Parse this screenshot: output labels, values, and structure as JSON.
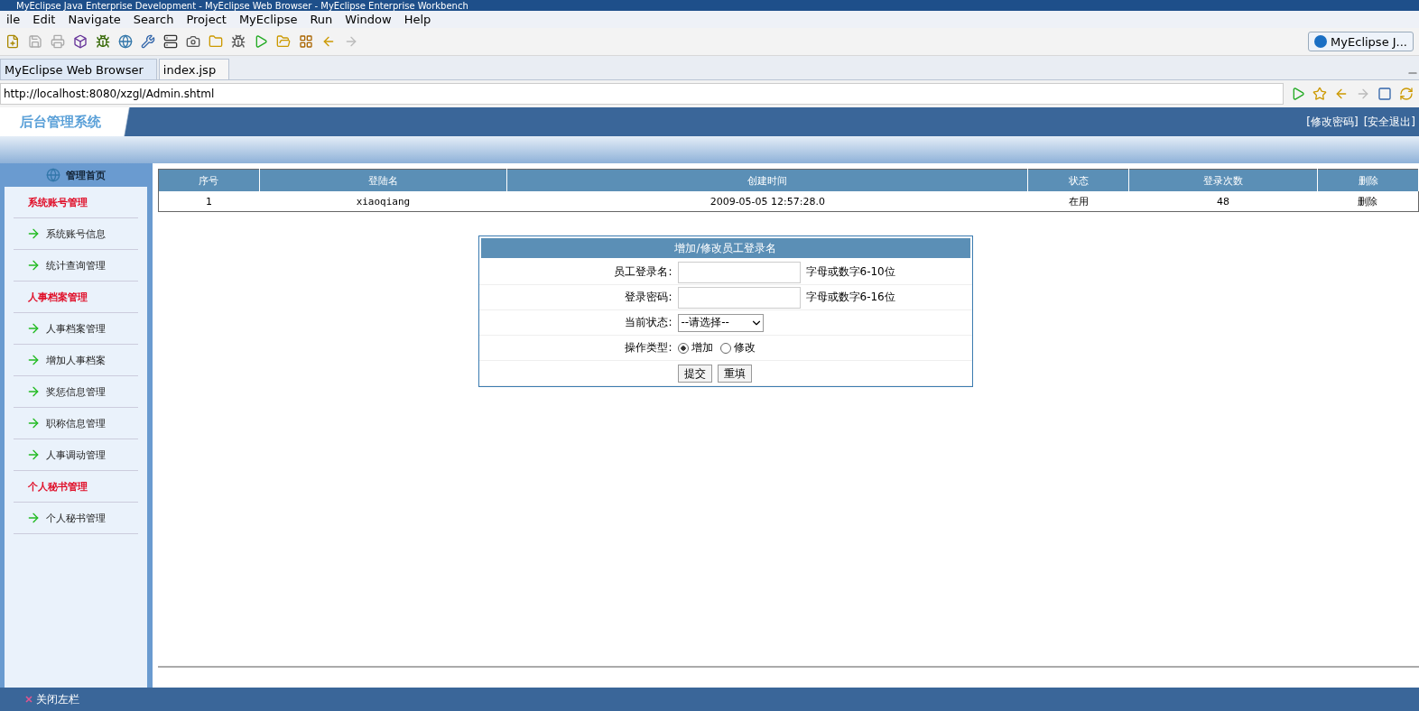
{
  "window": {
    "title": "MyEclipse Java Enterprise Development - MyEclipse Web Browser - MyEclipse Enterprise Workbench"
  },
  "menu": [
    "ile",
    "Edit",
    "Navigate",
    "Search",
    "Project",
    "MyEclipse",
    "Run",
    "Window",
    "Help"
  ],
  "perspective": {
    "label": "MyEclipse J..."
  },
  "tabs": [
    {
      "label": "MyEclipse Web Browser",
      "selected": true
    },
    {
      "label": "index.jsp",
      "selected": false
    }
  ],
  "address": {
    "value": "http://localhost:8080/xzgl/Admin.shtml"
  },
  "page": {
    "logo": "后台管理系统",
    "header_links": [
      "[修改密码]",
      "[安全退出]"
    ],
    "home": "管理首页",
    "sidebar": [
      {
        "kind": "section",
        "label": "系统账号管理"
      },
      {
        "kind": "link",
        "label": "系统账号信息"
      },
      {
        "kind": "link",
        "label": "统计查询管理"
      },
      {
        "kind": "section",
        "label": "人事档案管理"
      },
      {
        "kind": "link",
        "label": "人事档案管理"
      },
      {
        "kind": "link",
        "label": "增加人事档案"
      },
      {
        "kind": "link",
        "label": "奖惩信息管理"
      },
      {
        "kind": "link",
        "label": "职称信息管理"
      },
      {
        "kind": "link",
        "label": "人事调动管理"
      },
      {
        "kind": "section",
        "label": "个人秘书管理"
      },
      {
        "kind": "link",
        "label": "个人秘书管理"
      }
    ],
    "table": {
      "columns": [
        "序号",
        "登陆名",
        "创建时间",
        "状态",
        "登录次数",
        "删除"
      ],
      "rows": [
        [
          "1",
          "xiaoqiang",
          "2009-05-05 12:57:28.0",
          "在用",
          "48",
          "删除"
        ]
      ]
    },
    "form": {
      "title": "增加/修改员工登录名",
      "rows": [
        {
          "kind": "text",
          "label": "员工登录名:",
          "hint": "字母或数字6-10位"
        },
        {
          "kind": "text",
          "label": "登录密码:",
          "hint": "字母或数字6-16位"
        },
        {
          "kind": "select",
          "label": "当前状态:",
          "value": "--请选择--"
        },
        {
          "kind": "radio",
          "label": "操作类型:",
          "options": [
            {
              "label": "增加",
              "selected": true
            },
            {
              "label": "修改",
              "selected": false
            }
          ]
        },
        {
          "kind": "buttons",
          "buttons": [
            "提交",
            "重填"
          ]
        }
      ]
    },
    "footer": "关闭左栏"
  }
}
